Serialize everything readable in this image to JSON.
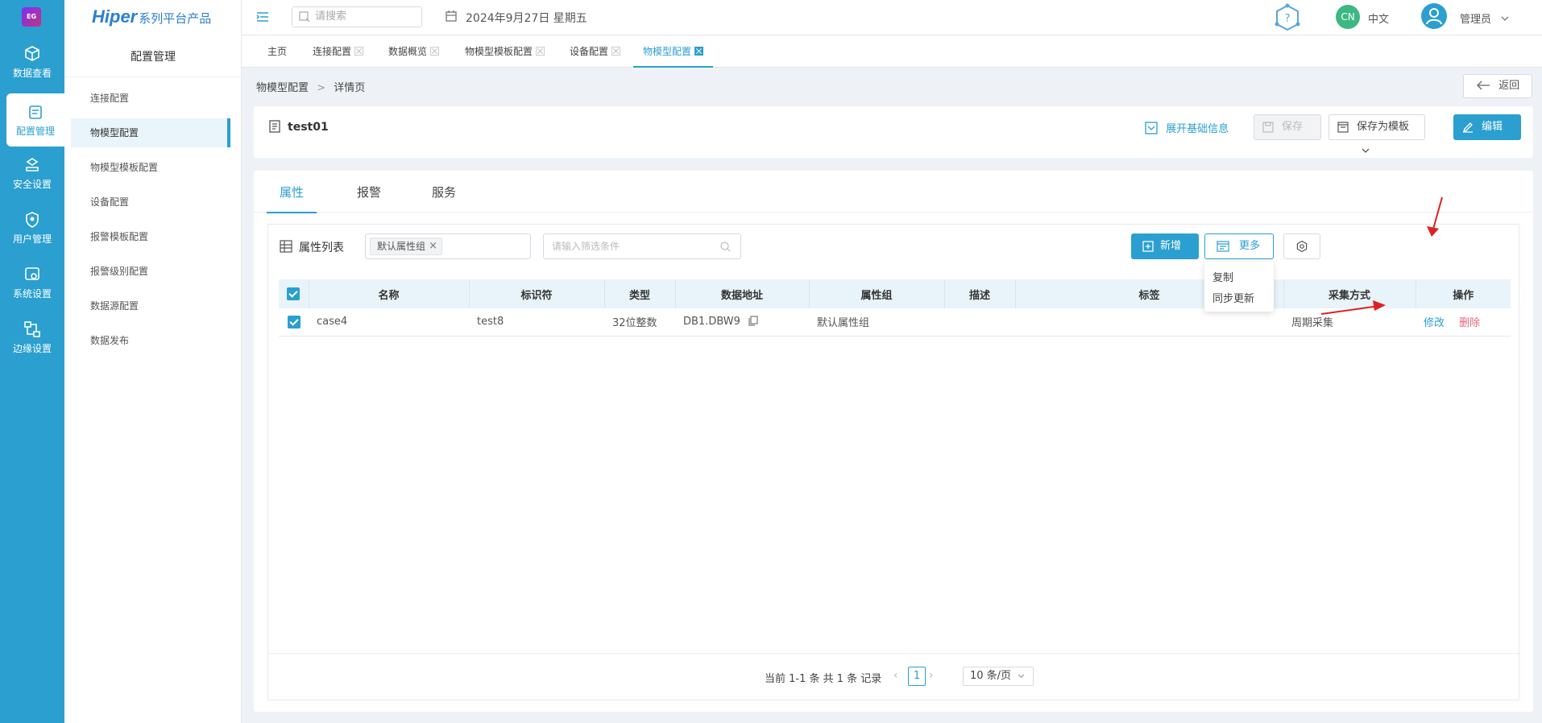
{
  "brand": {
    "name": "Hiper",
    "subtitle": "系列平台产品",
    "logo_text": "EG"
  },
  "icon_nav": [
    {
      "label": "数据查看",
      "icon": "cube-icon"
    },
    {
      "label": "配置管理",
      "icon": "config-icon"
    },
    {
      "label": "安全设置",
      "icon": "shield-cloud-icon"
    },
    {
      "label": "用户管理",
      "icon": "user-shield-icon"
    },
    {
      "label": "系统设置",
      "icon": "settings-gear-icon"
    },
    {
      "label": "边缘设置",
      "icon": "network-icon"
    }
  ],
  "sidebar": {
    "title": "配置管理",
    "items": [
      "连接配置",
      "物模型配置",
      "物模型模板配置",
      "设备配置",
      "报警模板配置",
      "报警级别配置",
      "数据源配置",
      "数据发布"
    ],
    "active": "物模型配置"
  },
  "topbar": {
    "search_placeholder": "请搜索",
    "date": "2024年9月27日 星期五",
    "lang_badge": "CN",
    "lang": "中文",
    "user": "管理员",
    "help_icon": "help-hex-icon"
  },
  "tabs": [
    "主页",
    "连接配置",
    "数据概览",
    "物模型模板配置",
    "设备配置",
    "物模型配置"
  ],
  "breadcrumb": {
    "parent": "物模型配置",
    "sep": ">",
    "current": "详情页"
  },
  "back_label": "返回",
  "header": {
    "title": "test01",
    "expand_label": "展开基础信息",
    "save_label": "保存",
    "save_template_label": "保存为模板",
    "edit_label": "编辑"
  },
  "panel_tabs": [
    "属性",
    "报警",
    "服务"
  ],
  "list": {
    "title": "属性列表",
    "group_chip": "默认属性组",
    "filter_placeholder": "请输入筛选条件",
    "add_label": "新增",
    "more_label": "更多",
    "more_menu": [
      "复制",
      "同步更新"
    ]
  },
  "table": {
    "columns": [
      "名称",
      "标识符",
      "类型",
      "数据地址",
      "属性组",
      "描述",
      "标签",
      "采集方式",
      "操作"
    ],
    "rows": [
      {
        "name": "case4",
        "identifier": "test8",
        "type": "32位整数",
        "address": "DB1.DBW9",
        "group": "默认属性组",
        "desc": "",
        "tags": "",
        "mode": "周期采集",
        "edit": "修改",
        "delete": "删除"
      }
    ]
  },
  "pagination": {
    "summary": "当前 1-1 条 共 1 条 记录",
    "page": "1",
    "size": "10 条/页"
  },
  "colors": {
    "accent": "#2a9fd0",
    "sidebar_bg": "#2a9fd0",
    "danger": "#e5637a",
    "annotation": "#e02020"
  }
}
